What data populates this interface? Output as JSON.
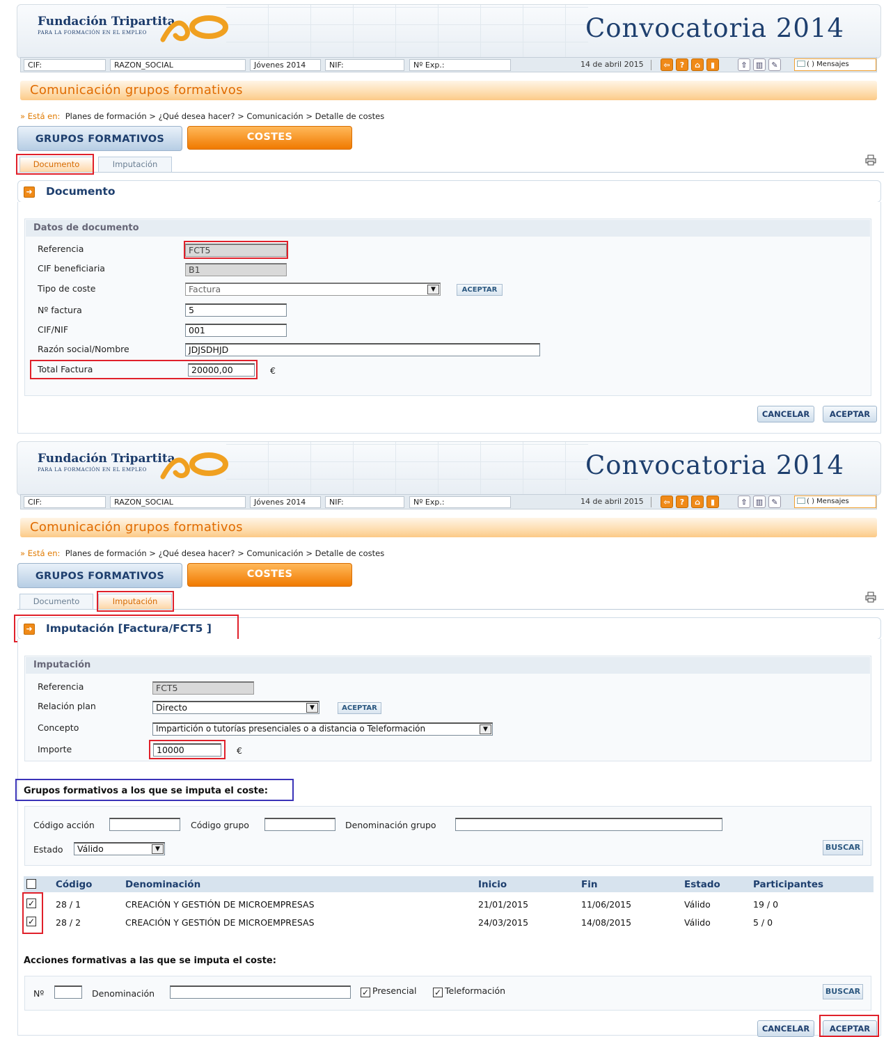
{
  "header": {
    "org_name": "Fundación Tripartita",
    "org_sub": "PARA LA FORMACIÓN EN EL EMPLEO",
    "convocatoria": "Convocatoria 2014",
    "cif_label": "CIF:",
    "razon_social": "RAZON_SOCIAL",
    "programa": "Jóvenes 2014",
    "nif_label": "NIF:",
    "exp_label": "Nº Exp.:",
    "date": "14 de abril 2015",
    "mensajes": "( ) Mensajes"
  },
  "page_title": "Comunicación grupos formativos",
  "breadcrumb": {
    "prefix": "» Está en:",
    "path": "Planes de formación > ¿Qué desea hacer? > Comunicación > Detalle de costes"
  },
  "tabs": {
    "grupos": "GRUPOS FORMATIVOS",
    "costes": "COSTES",
    "documento": "Documento",
    "imputacion": "Imputación"
  },
  "documento": {
    "section_title": "Documento",
    "panel_title": "Datos de documento",
    "referencia_label": "Referencia",
    "referencia": "FCT5",
    "cif_label": "CIF beneficiaria",
    "cif": "B1",
    "tipo_label": "Tipo de coste",
    "tipo": "Factura",
    "tipo_btn": "ACEPTAR",
    "factura_label": "Nº factura",
    "factura": "5",
    "cifnif_label": "CIF/NIF",
    "cifnif": "001",
    "razon_label": "Razón social/Nombre",
    "razon": "JDJSDHJD",
    "total_label": "Total Factura",
    "total": "20000,00",
    "currency": "€",
    "cancel": "CANCELAR",
    "accept": "ACEPTAR"
  },
  "imputacion": {
    "section_title": "Imputación [Factura/FCT5 ]",
    "panel_title": "Imputación",
    "referencia_label": "Referencia",
    "referencia": "FCT5",
    "relacion_label": "Relación plan",
    "relacion": "Directo",
    "relacion_btn": "ACEPTAR",
    "concepto_label": "Concepto",
    "concepto": "Impartición o tutorías presenciales o a distancia o Teleformación",
    "importe_label": "Importe",
    "importe": "10000",
    "currency": "€",
    "grupos_heading": "Grupos formativos a los que se imputa el coste:",
    "codigo_accion_label": "Código acción",
    "codigo_grupo_label": "Código grupo",
    "denominacion_grupo_label": "Denominación grupo",
    "estado_label": "Estado",
    "estado": "Válido",
    "buscar": "BUSCAR",
    "columns": [
      "Código",
      "Denominación",
      "Inicio",
      "Fin",
      "Estado",
      "Participantes"
    ],
    "rows": [
      {
        "checked": true,
        "codigo": "28 / 1",
        "denominacion": "CREACIÓN Y GESTIÓN DE MICROEMPRESAS",
        "inicio": "21/01/2015",
        "fin": "11/06/2015",
        "estado": "Válido",
        "participantes": "19 / 0"
      },
      {
        "checked": true,
        "codigo": "28 / 2",
        "denominacion": "CREACIÓN Y GESTIÓN DE MICROEMPRESAS",
        "inicio": "24/03/2015",
        "fin": "14/08/2015",
        "estado": "Válido",
        "participantes": "5 / 0"
      }
    ],
    "acciones_heading": "Acciones formativas a las que se imputa el coste:",
    "num_label": "Nº",
    "denominacion_label": "Denominación",
    "presencial": "Presencial",
    "teleformacion": "Teleformación",
    "buscar2": "BUSCAR",
    "cancel": "CANCELAR",
    "accept": "ACEPTAR"
  },
  "colors": {
    "accent": "#f08a18",
    "navy": "#1e3f6e",
    "highlight_red": "#e0202a",
    "highlight_blue": "#3a33b8"
  }
}
